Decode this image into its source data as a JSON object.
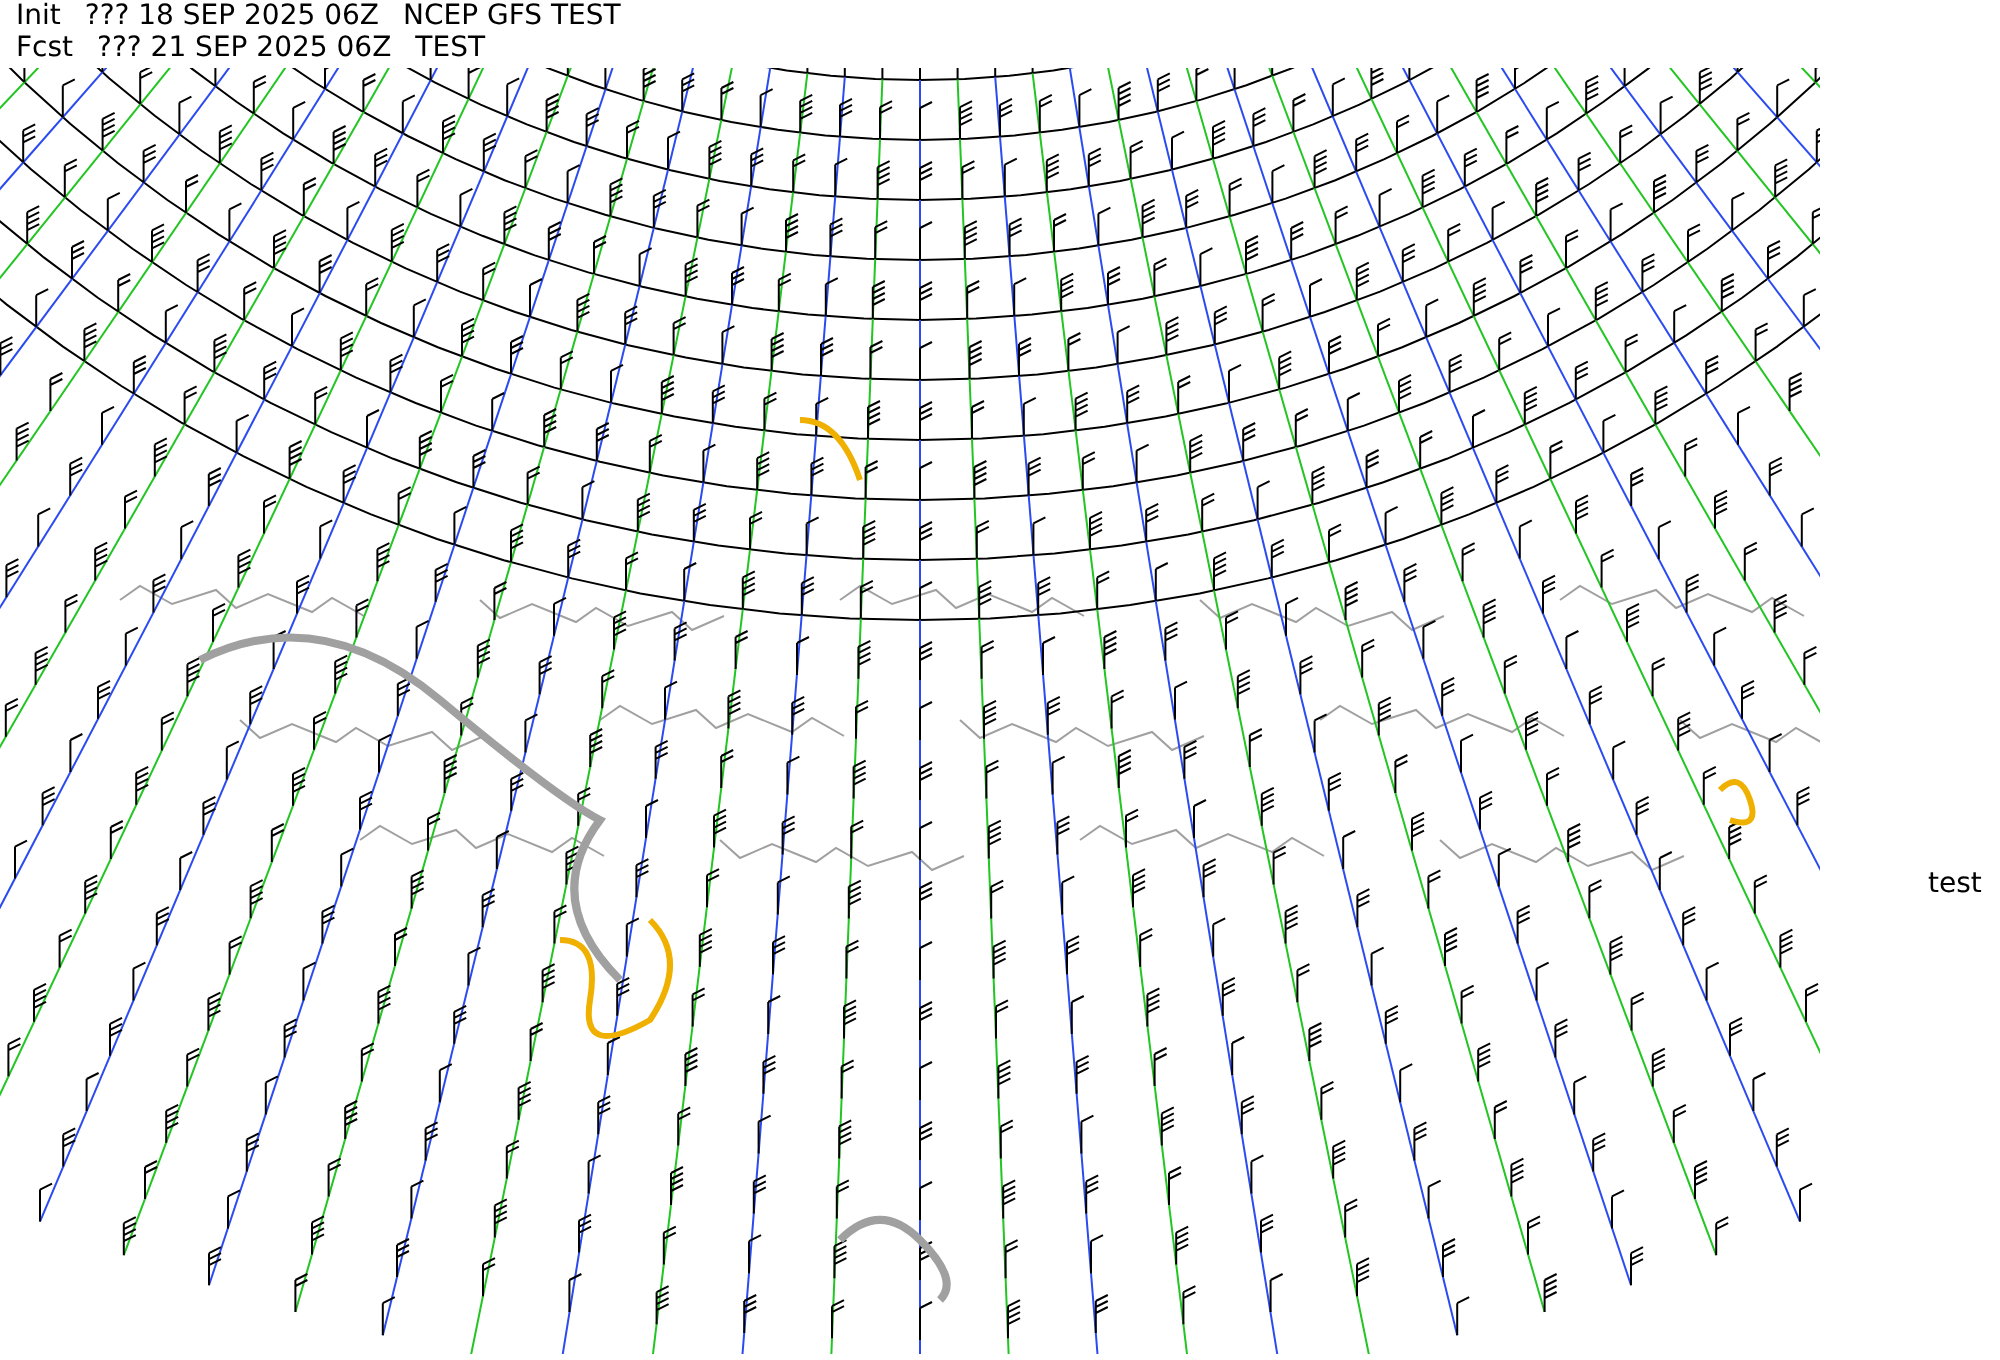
{
  "header": [
    {
      "label": "Init",
      "time": "??? 18 SEP 2025 06Z",
      "note": "NCEP GFS TEST"
    },
    {
      "label": "Fcst",
      "time": "??? 21 SEP 2025 06Z",
      "note": "TEST"
    }
  ],
  "side_label": "test"
}
